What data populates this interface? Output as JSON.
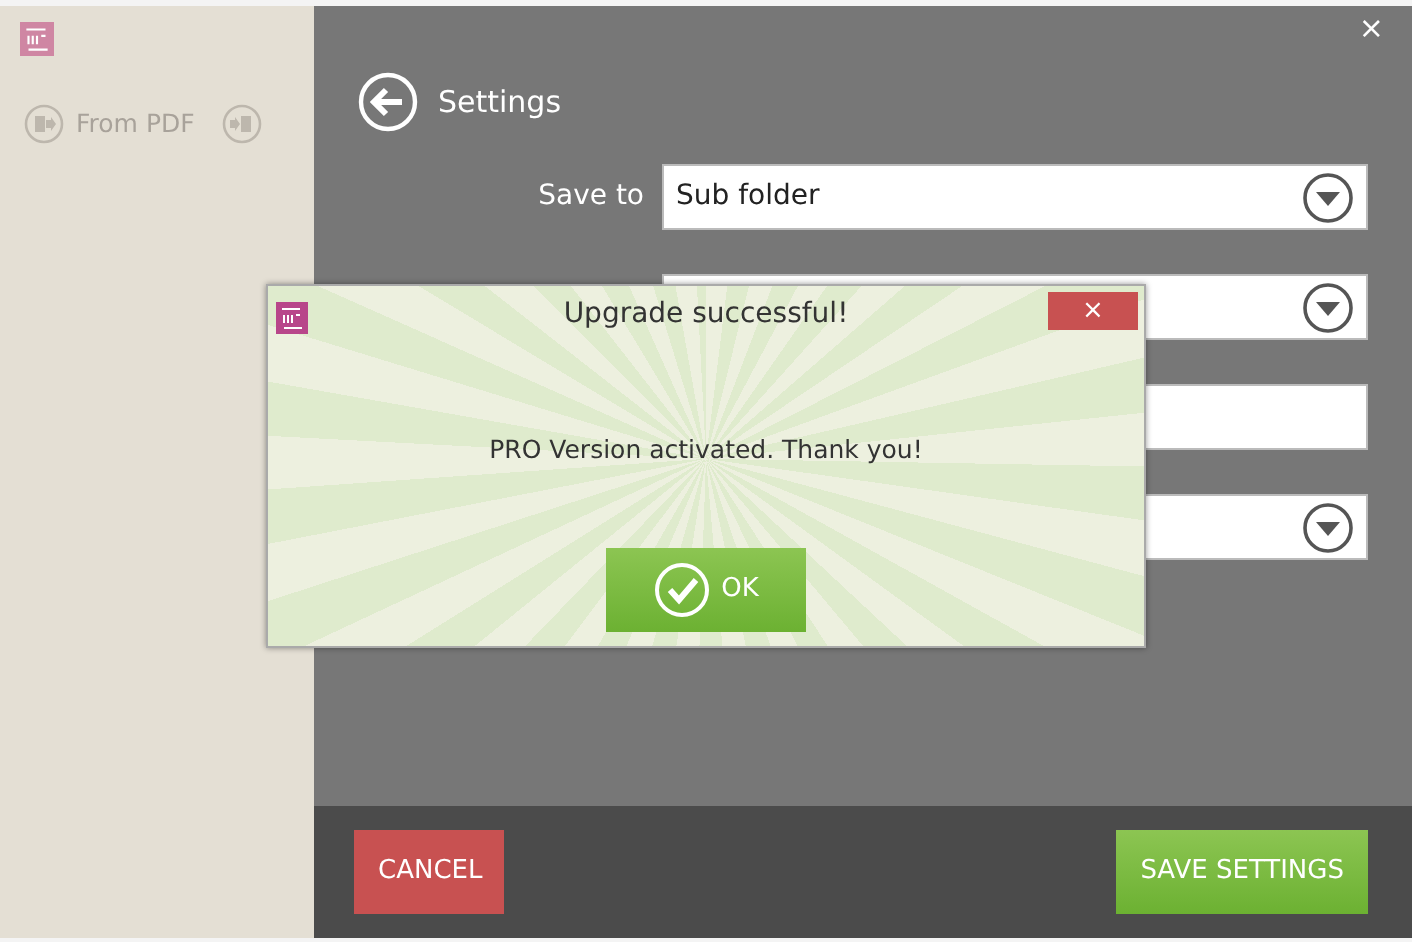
{
  "app": {
    "close": "×"
  },
  "sidebar": {
    "items": [
      {
        "label": "From PDF",
        "disabled": true
      }
    ]
  },
  "settings": {
    "title": "Settings",
    "fields": [
      {
        "kind": "select",
        "label": "Save to",
        "value": "Sub folder"
      },
      {
        "kind": "select"
      },
      {
        "kind": "text"
      },
      {
        "kind": "select"
      }
    ]
  },
  "footer": {
    "buttons": [
      {
        "label": "CANCEL",
        "kind": "danger"
      },
      {
        "label": "SAVE SETTINGS",
        "kind": "success"
      }
    ]
  },
  "dialog": {
    "title": "Upgrade successful!",
    "close": "×",
    "message": "PRO Version activated. Thank you!",
    "button": "OK"
  }
}
